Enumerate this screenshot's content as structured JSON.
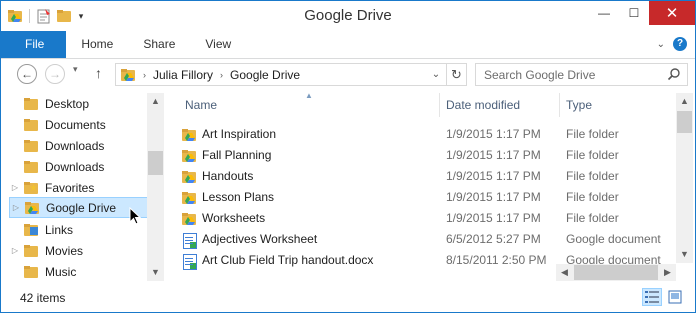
{
  "window": {
    "title": "Google Drive",
    "controls": {
      "minimize": "—",
      "maximize": "☐",
      "close": "✕"
    }
  },
  "ribbon": {
    "tabs": [
      {
        "label": "File",
        "active": true
      },
      {
        "label": "Home"
      },
      {
        "label": "Share"
      },
      {
        "label": "View"
      }
    ]
  },
  "address_bar": {
    "crumbs": [
      "Julia Fillory",
      "Google Drive"
    ],
    "search_placeholder": "Search Google Drive"
  },
  "nav_pane": {
    "items": [
      {
        "label": "Desktop",
        "icon": "folder-icon",
        "expandable": false
      },
      {
        "label": "Documents",
        "icon": "documents-icon",
        "expandable": false
      },
      {
        "label": "Downloads",
        "icon": "folder-icon",
        "expandable": false
      },
      {
        "label": "Downloads",
        "icon": "downloads-icon",
        "expandable": false
      },
      {
        "label": "Favorites",
        "icon": "favorites-icon",
        "expandable": true
      },
      {
        "label": "Google Drive",
        "icon": "google-drive-folder-icon",
        "expandable": true,
        "selected": true
      },
      {
        "label": "Links",
        "icon": "links-icon",
        "expandable": false
      },
      {
        "label": "Movies",
        "icon": "folder-icon",
        "expandable": true
      },
      {
        "label": "Music",
        "icon": "folder-icon",
        "expandable": false
      }
    ]
  },
  "file_list": {
    "columns": [
      "Name",
      "Date modified",
      "Type"
    ],
    "sorted_by": "Name",
    "rows": [
      {
        "name": "Art Inspiration",
        "date": "1/9/2015 1:17 PM",
        "type": "File folder",
        "icon": "google-drive-folder-icon"
      },
      {
        "name": "Fall Planning",
        "date": "1/9/2015 1:17 PM",
        "type": "File folder",
        "icon": "google-drive-folder-icon"
      },
      {
        "name": "Handouts",
        "date": "1/9/2015 1:17 PM",
        "type": "File folder",
        "icon": "google-drive-folder-icon"
      },
      {
        "name": "Lesson Plans",
        "date": "1/9/2015 1:17 PM",
        "type": "File folder",
        "icon": "google-drive-folder-icon"
      },
      {
        "name": "Worksheets",
        "date": "1/9/2015 1:17 PM",
        "type": "File folder",
        "icon": "google-drive-folder-icon"
      },
      {
        "name": "Adjectives Worksheet",
        "date": "6/5/2012 5:27 PM",
        "type": "Google document",
        "icon": "google-doc-icon"
      },
      {
        "name": "Art Club Field Trip handout.docx",
        "date": "8/15/2011 2:50 PM",
        "type": "Google document",
        "icon": "google-doc-icon"
      }
    ]
  },
  "status_bar": {
    "item_count": "42 items"
  },
  "colors": {
    "accent": "#1979ca",
    "close": "#c7292a",
    "selection_bg": "#cce8ff",
    "selection_border": "#99d1ff",
    "header_text": "#4c607a",
    "folder": "#e8b74a"
  }
}
